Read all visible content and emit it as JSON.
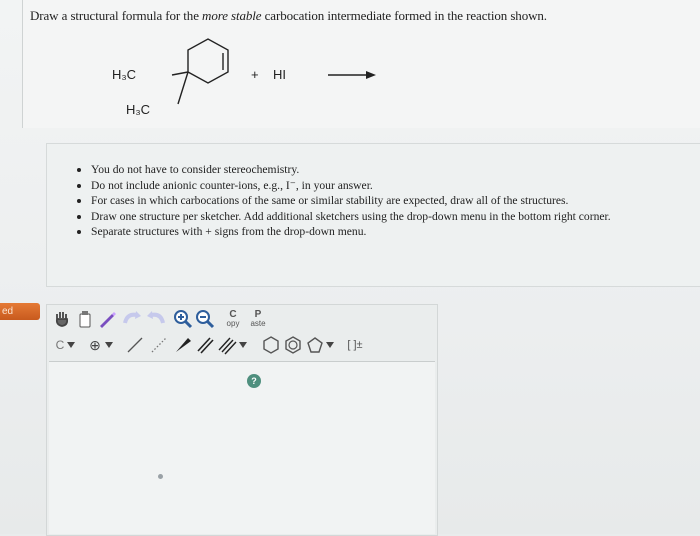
{
  "question": {
    "prompt_before": "Draw a structural formula for the ",
    "prompt_emphasis": "more stable",
    "prompt_after": " carbocation intermediate formed in the reaction shown."
  },
  "reaction": {
    "methyl_top": "H₃C",
    "methyl_bottom": "H₃C",
    "plus": "+",
    "reagent": "HI"
  },
  "notes": [
    "You do not have to consider stereochemistry.",
    "Do not include anionic counter-ions, e.g., I⁻, in your answer.",
    "For cases in which carbocations of the same or similar stability are expected, draw all of the structures.",
    "Draw one structure per sketcher. Add additional sketchers using the drop-down menu in the bottom right corner.",
    "Separate structures with + signs from the drop-down menu."
  ],
  "side_tab": {
    "label": "ed"
  },
  "toolbar": {
    "copy_top": "C",
    "copy_bottom": "opy",
    "paste_top": "P",
    "paste_bottom": "aste",
    "element": "C",
    "charge": "⊕",
    "bracket": "[ ]±"
  },
  "help_label": "?"
}
